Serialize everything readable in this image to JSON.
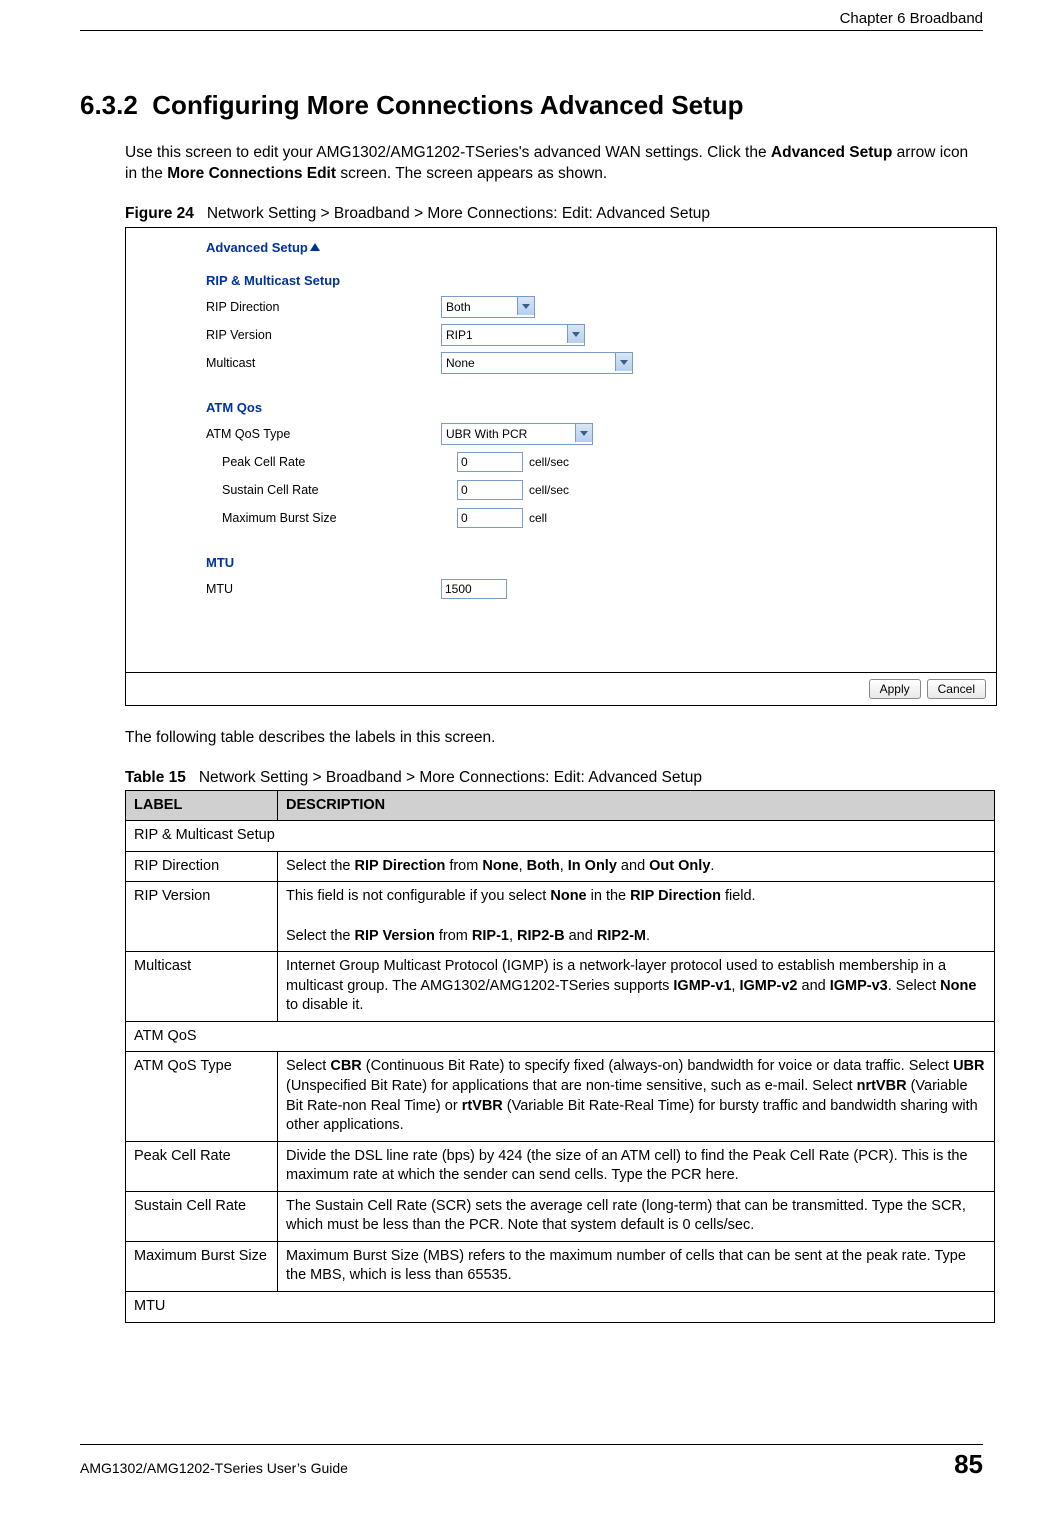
{
  "chapterHeader": "Chapter 6 Broadband",
  "section": {
    "number": "6.3.2",
    "title": "Configuring More Connections Advanced Setup"
  },
  "intro": {
    "p1_a": "Use this screen to edit your AMG1302/AMG1202-TSeries's advanced WAN settings. Click the ",
    "p1_b": "Advanced Setup",
    "p1_c": " arrow icon in the ",
    "p1_d": "More Connections Edit",
    "p1_e": " screen. The screen appears as shown."
  },
  "figure": {
    "label": "Figure 24",
    "caption": "Network Setting > Broadband > More Connections: Edit: Advanced Setup"
  },
  "sshot": {
    "title": "Advanced Setup",
    "sections": {
      "ripMulticast": {
        "heading": "RIP & Multicast Setup",
        "ripDirection": {
          "label": "RIP Direction",
          "value": "Both"
        },
        "ripVersion": {
          "label": "RIP Version",
          "value": "RIP1"
        },
        "multicast": {
          "label": "Multicast",
          "value": "None"
        }
      },
      "atmQos": {
        "heading": "ATM Qos",
        "type": {
          "label": "ATM QoS Type",
          "value": "UBR With PCR"
        },
        "pcr": {
          "label": "Peak Cell Rate",
          "value": "0",
          "unit": "cell/sec"
        },
        "scr": {
          "label": "Sustain Cell Rate",
          "value": "0",
          "unit": "cell/sec"
        },
        "mbs": {
          "label": "Maximum Burst Size",
          "value": "0",
          "unit": "cell"
        }
      },
      "mtu": {
        "heading": "MTU",
        "mtu": {
          "label": "MTU",
          "value": "1500"
        }
      }
    },
    "buttons": {
      "apply": "Apply",
      "cancel": "Cancel"
    }
  },
  "between": "The following table describes the labels in this screen.",
  "table": {
    "label": "Table 15",
    "caption": "Network Setting > Broadband > More Connections: Edit: Advanced Setup",
    "headers": {
      "col1": "LABEL",
      "col2": "DESCRIPTION"
    },
    "rows": {
      "g1": "RIP & Multicast Setup",
      "r1_label": "RIP Direction",
      "r1": {
        "a": "Select the ",
        "b": "RIP Direction",
        "c": " from ",
        "d": "None",
        "e": ", ",
        "f": "Both",
        "g": ", ",
        "h": "In Only",
        "i": " and ",
        "j": "Out Only",
        "k": "."
      },
      "r2_label": "RIP Version",
      "r2": {
        "p1a": "This field is not configurable if you select ",
        "p1b": "None",
        "p1c": " in the ",
        "p1d": "RIP Direction",
        "p1e": " field.",
        "p2a": "Select the ",
        "p2b": "RIP Version",
        "p2c": " from ",
        "p2d": "RIP-1",
        "p2e": ", ",
        "p2f": "RIP2-B",
        "p2g": " and ",
        "p2h": "RIP2-M",
        "p2i": "."
      },
      "r3_label": "Multicast",
      "r3": {
        "a": "Internet Group Multicast Protocol (IGMP) is a network-layer protocol used to establish membership in a multicast group. The AMG1302/AMG1202-TSeries supports ",
        "b": "IGMP-v1",
        "c": ", ",
        "d": "IGMP-v2",
        "e": " and ",
        "f": "IGMP-v3",
        "g": ". Select ",
        "h": "None",
        "i": " to disable it."
      },
      "g2": "ATM QoS",
      "r4_label": "ATM QoS Type",
      "r4": {
        "a": "Select ",
        "b": "CBR",
        "c": " (Continuous Bit Rate) to specify fixed (always-on) bandwidth for voice or data traffic. Select ",
        "d": "UBR",
        "e": " (Unspecified Bit Rate) for applications that are non-time sensitive, such as e-mail. Select ",
        "f": "nrtVBR",
        "g": " (Variable Bit Rate-non Real Time) or ",
        "h": "rtVBR",
        "i": " (Variable Bit Rate-Real Time) for bursty traffic and bandwidth sharing with other applications."
      },
      "r5_label": "Peak Cell Rate",
      "r5": "Divide the DSL line rate (bps) by 424 (the size of an ATM cell) to find the Peak Cell Rate (PCR). This is the maximum rate at which the sender can send cells. Type the PCR here.",
      "r6_label": "Sustain Cell Rate",
      "r6": "The Sustain Cell Rate (SCR) sets the average cell rate (long-term) that can be transmitted. Type the SCR, which must be less than the PCR. Note that system default is 0 cells/sec.",
      "r7_label": "Maximum Burst Size",
      "r7": "Maximum Burst Size (MBS) refers to the maximum number of cells that can be sent at the peak rate. Type the MBS, which is less than 65535.",
      "g3": "MTU"
    }
  },
  "footer": {
    "guide": "AMG1302/AMG1202-TSeries User’s Guide",
    "page": "85"
  }
}
